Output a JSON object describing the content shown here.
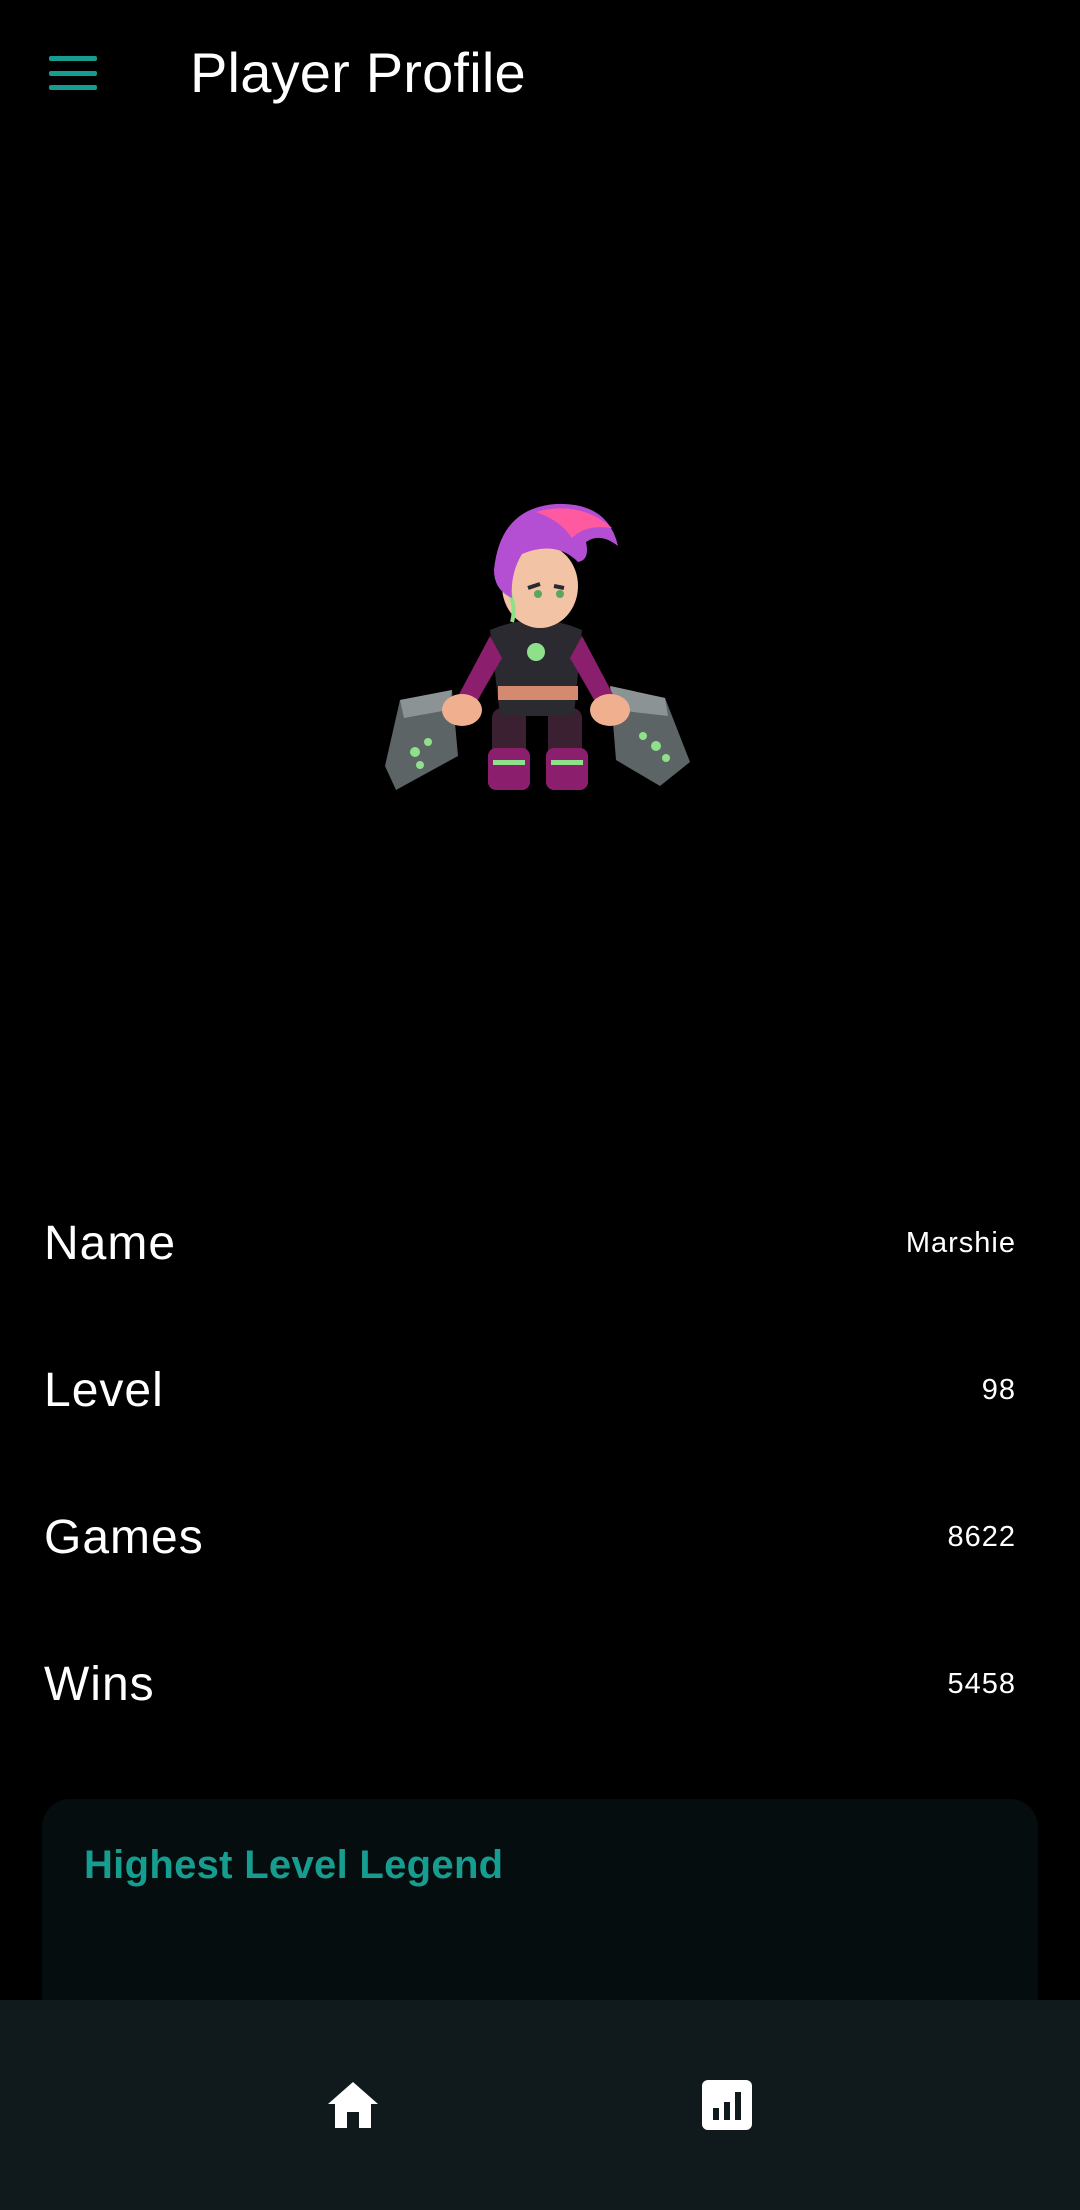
{
  "header": {
    "title": "Player Profile",
    "menu_icon": "hamburger-menu-icon",
    "accent_color": "#179d8f"
  },
  "hero": {
    "image": "legend-character-illustration"
  },
  "stats": [
    {
      "label": "Name",
      "value": "Marshie"
    },
    {
      "label": "Level",
      "value": "98"
    },
    {
      "label": "Games",
      "value": "8622"
    },
    {
      "label": "Wins",
      "value": "5458"
    }
  ],
  "highest_legend_card": {
    "title": "Highest Level Legend",
    "peek_text": ""
  },
  "bottom_nav": {
    "items": [
      {
        "icon": "home-icon"
      },
      {
        "icon": "stats-chart-icon"
      }
    ],
    "background": "#101a1c"
  }
}
